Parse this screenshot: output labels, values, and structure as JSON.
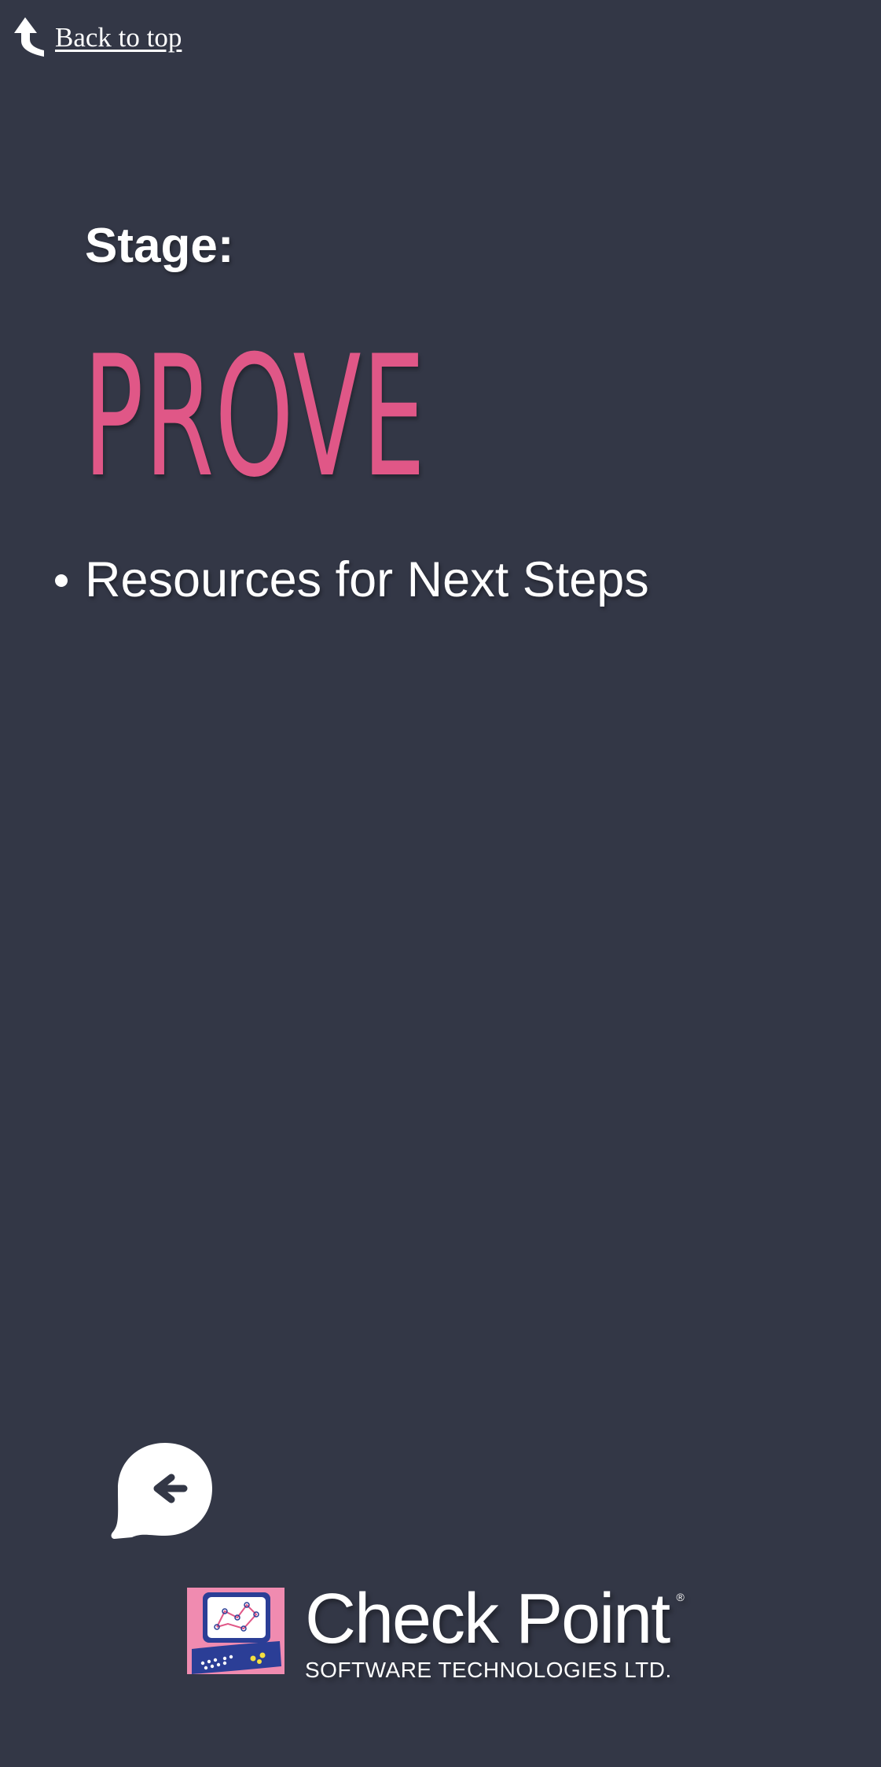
{
  "nav": {
    "back_to_top_label": "Back to top",
    "back_to_top_icon": "curved-up-arrow-icon"
  },
  "stage": {
    "label": "Stage:",
    "name": "PROVE",
    "name_color": "#e05787"
  },
  "resources": {
    "items": [
      {
        "label": "Resources for Next Steps"
      }
    ]
  },
  "back_button": {
    "icon": "back-arrow-speech-bubble-icon"
  },
  "brand": {
    "name": "Check Point",
    "registered": "®",
    "tagline": "SOFTWARE TECHNOLOGIES LTD.",
    "logo_colors": {
      "pink": "#f08bb0",
      "navy": "#2b3e96",
      "yellow": "#f5e040"
    }
  },
  "theme": {
    "background": "#333746",
    "text": "#ffffff"
  }
}
